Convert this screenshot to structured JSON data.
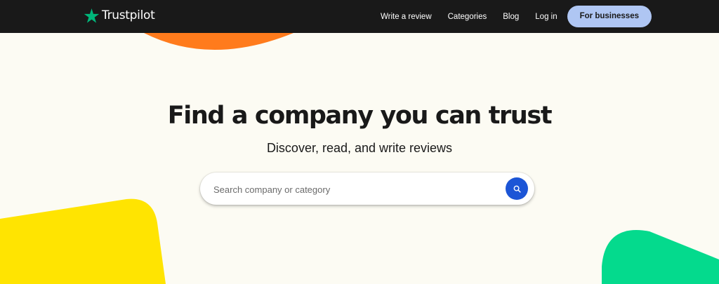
{
  "brand": {
    "name": "Trustpilot",
    "star_color": "#00b67a"
  },
  "nav": {
    "links": [
      {
        "label": "Write a review"
      },
      {
        "label": "Categories"
      },
      {
        "label": "Blog"
      },
      {
        "label": "Log in"
      }
    ],
    "business_button": "For businesses"
  },
  "hero": {
    "title": "Find a company you can trust",
    "subtitle": "Discover, read, and write reviews"
  },
  "search": {
    "placeholder": "Search company or category",
    "value": "",
    "icon": "search-icon"
  },
  "colors": {
    "nav_background": "#191919",
    "page_background": "#fcfbf3",
    "business_button": "#afc6f3",
    "search_button": "#1c55d6",
    "orange_shape": "#ff7b1c",
    "yellow_shape": "#ffe401",
    "green_shape": "#04da8d"
  }
}
